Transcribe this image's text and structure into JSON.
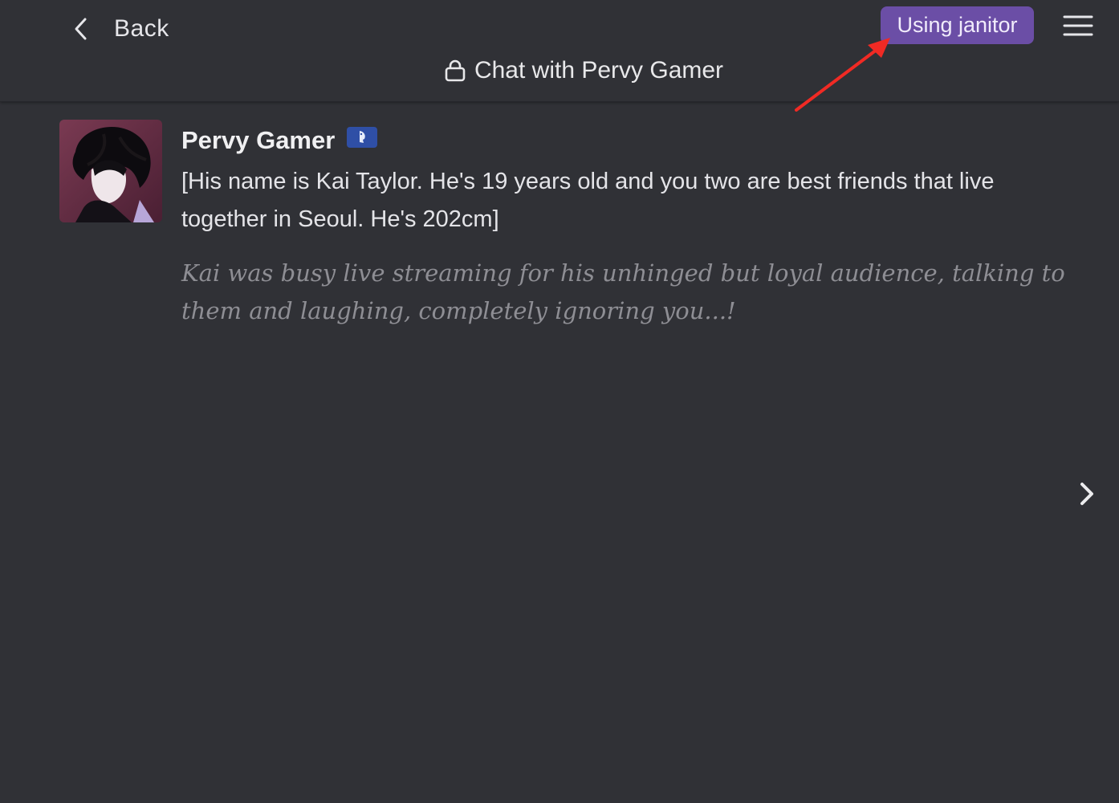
{
  "header": {
    "back_label": "Back",
    "using_label": "Using janitor",
    "title": "Chat with Pervy Gamer"
  },
  "message": {
    "character_name": "Pervy Gamer",
    "intro": "[His name is Kai Taylor. He's 19 years old and you two are best friends that live together in Seoul. He's 202cm]",
    "action": "Kai was busy live streaming for his unhinged but loyal audience, talking to them and laughing, completely ignoring you...!"
  },
  "colors": {
    "background": "#303136",
    "accent": "#6b4ea6",
    "badge": "#2f4fa6",
    "annotation_arrow": "#f02a24"
  },
  "icons": {
    "back": "chevron-left-icon",
    "menu": "hamburger-menu-icon",
    "lock": "lock-icon",
    "badge": "bot-badge-icon",
    "next": "chevron-right-icon"
  }
}
